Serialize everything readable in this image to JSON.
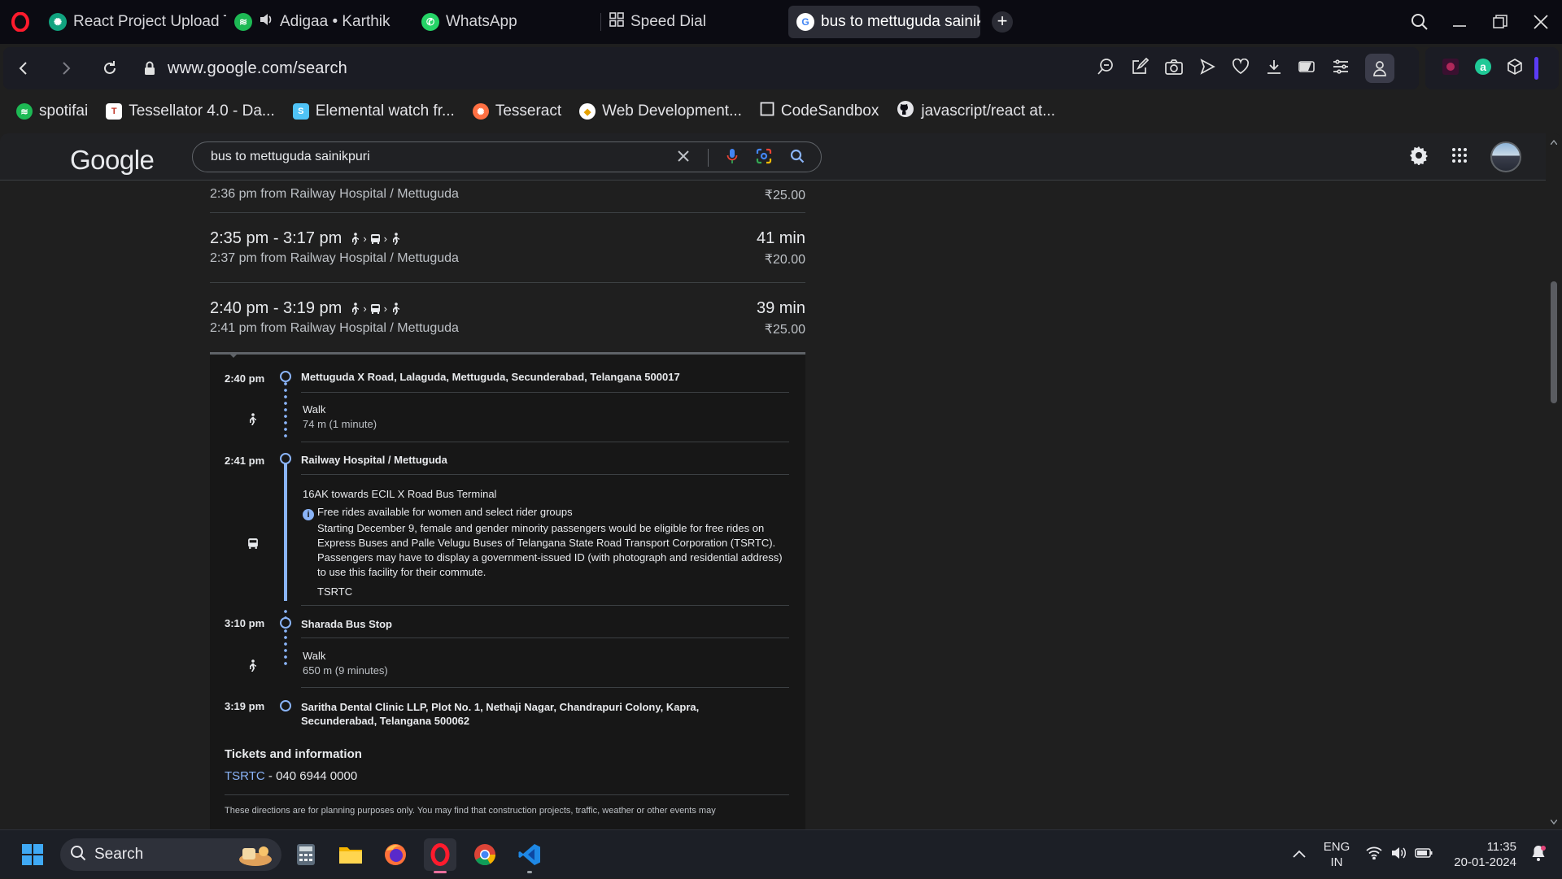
{
  "browser": {
    "tabs": [
      {
        "label": "React Project Upload Ti",
        "icon": "chatgpt-icon",
        "color": "#10a37f"
      },
      {
        "label": "Adigaa • Karthik",
        "icon": "spotify-icon",
        "color": "#1db954"
      },
      {
        "label": "WhatsApp",
        "icon": "whatsapp-icon",
        "color": "#25d366"
      },
      {
        "label": "Speed Dial",
        "icon": "speed-dial-icon"
      },
      {
        "label": "bus to mettuguda sainik",
        "icon": "google-icon",
        "active": true
      }
    ],
    "url": "www.google.com/search",
    "bookmarks": [
      {
        "label": "spotifai",
        "icon": "spotify-icon",
        "color": "#1db954"
      },
      {
        "label": "Tessellator 4.0 - Da...",
        "icon": "tessellator-icon",
        "color": "#c0392b"
      },
      {
        "label": "Elemental watch fr...",
        "icon": "elemental-icon",
        "color": "#4fc3f7"
      },
      {
        "label": "Tesseract",
        "icon": "tesseract-icon",
        "color": "#ff7043"
      },
      {
        "label": "Web Development...",
        "icon": "web-dev-icon",
        "color": "#fbc02d"
      },
      {
        "label": "CodeSandbox",
        "icon": "codesandbox-icon"
      },
      {
        "label": "javascript/react at...",
        "icon": "github-icon"
      }
    ]
  },
  "google": {
    "logo": "Google",
    "query": "bus to mettuguda sainikpuri"
  },
  "routes": [
    {
      "times": "",
      "sub": "2:36 pm from Railway Hospital / Mettuguda",
      "duration": "",
      "fare": "₹25.00"
    },
    {
      "times": "2:35 pm - 3:17 pm",
      "sub": "2:37 pm from Railway Hospital / Mettuguda",
      "duration": "41 min",
      "fare": "₹20.00"
    },
    {
      "times": "2:40 pm - 3:19 pm",
      "sub": "2:41 pm from Railway Hospital / Mettuguda",
      "duration": "39 min",
      "fare": "₹25.00"
    }
  ],
  "details": {
    "stops": [
      {
        "time": "2:40 pm",
        "place": "Mettuguda X Road, Lalaguda, Mettuguda, Secunderabad, Telangana 500017"
      },
      {
        "time": "2:41 pm",
        "place": "Railway Hospital / Mettuguda"
      },
      {
        "time": "3:10 pm",
        "place": "Sharada Bus Stop"
      },
      {
        "time": "3:19 pm",
        "place": "Saritha Dental Clinic LLP, Plot No. 1, Nethaji Nagar, Chandrapuri Colony, Kapra, Secunderabad, Telangana 500062"
      }
    ],
    "walk1": {
      "label": "Walk",
      "distance": "74 m (1 minute)"
    },
    "bus": {
      "line": "16AK towards ECIL X Road Bus Terminal",
      "notice_title": "Free rides available for women and select rider groups",
      "notice_body": "Starting December 9, female and gender minority passengers would be eligible for free rides on Express Buses and Palle Velugu Buses of Telangana State Road Transport Corporation (TSRTC). Passengers may have to display a government-issued ID (with photograph and residential address) to use this facility for their commute.",
      "agency": "TSRTC"
    },
    "walk2": {
      "label": "Walk",
      "distance": "650 m (9 minutes)"
    },
    "tickets_title": "Tickets and information",
    "tickets_agency": "TSRTC",
    "tickets_phone": " - 040 6944 0000",
    "disclaimer": "These directions are for planning purposes only. You may find that construction projects, traffic, weather or other events may"
  },
  "taskbar": {
    "search_label": "Search",
    "lang_top": "ENG",
    "lang_bottom": "IN",
    "time": "11:35",
    "date": "20-01-2024"
  },
  "colors": {
    "accent": "#8ab4f8",
    "opera": "#ff1b2d"
  }
}
